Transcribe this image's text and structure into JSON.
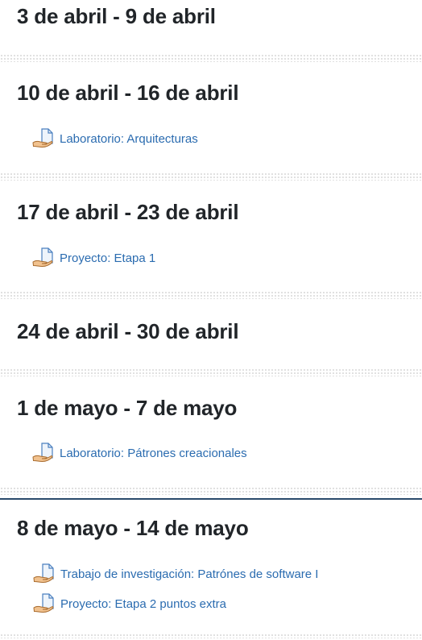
{
  "weeks": [
    {
      "title": "3 de abril - 9 de abril",
      "activities": []
    },
    {
      "title": "10 de abril - 16 de abril",
      "activities": [
        {
          "label": "Laboratorio: Arquitecturas",
          "icon": "assignment-icon"
        }
      ]
    },
    {
      "title": "17 de abril - 23 de abril",
      "activities": [
        {
          "label": "Proyecto: Etapa 1",
          "icon": "assignment-icon"
        }
      ]
    },
    {
      "title": "24 de abril - 30 de abril",
      "activities": []
    },
    {
      "title": "1 de mayo - 7 de mayo",
      "activities": [
        {
          "label": "Laboratorio: Pátrones creacionales",
          "icon": "assignment-icon"
        }
      ]
    },
    {
      "title": "8 de mayo - 14 de mayo",
      "activities": [
        {
          "label": "Trabajo de investigación: Patrónes de software I",
          "icon": "assignment-icon"
        },
        {
          "label": "Proyecto: Etapa 2 puntos extra",
          "icon": "assignment-icon"
        }
      ]
    }
  ],
  "colors": {
    "link": "#2b6cb0",
    "heading": "#212529",
    "current_week_border": "#2a4a6b"
  }
}
